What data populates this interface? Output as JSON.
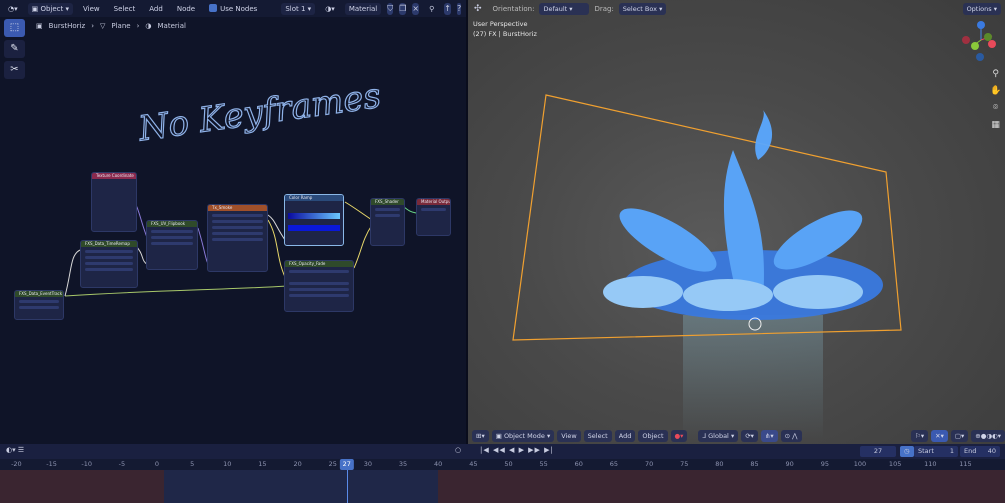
{
  "node_editor": {
    "header": {
      "editor_type_icon": "node-editor-icon",
      "mode": "Object",
      "menus": [
        "View",
        "Select",
        "Add",
        "Node"
      ],
      "use_nodes_label": "Use Nodes",
      "use_nodes": true,
      "slot": "Slot 1",
      "material": "Material"
    },
    "breadcrumb": [
      "BurstHoriz",
      "Plane",
      "Material"
    ],
    "annotation": "No Keyframes",
    "nodes": [
      {
        "title": "Texture Coordinate",
        "color": "#8a2a4e"
      },
      {
        "title": "FXS_UV_Flipbook",
        "color": "#2f4a2a"
      },
      {
        "title": "Tx_Smoke",
        "color": "#a0502a"
      },
      {
        "title": "Color Ramp",
        "color": "#2a4a7a"
      },
      {
        "title": "FXS_Shader",
        "color": "#2f4a2a"
      },
      {
        "title": "Material Output",
        "color": "#7a2a3a"
      },
      {
        "title": "FXS_Data_TimeRemap",
        "color": "#2f4a2a"
      },
      {
        "title": "FXS_Opacity_Fade",
        "color": "#2f4a2a"
      },
      {
        "title": "FXS_Data_EventTrack",
        "color": "#2f4a2a"
      }
    ]
  },
  "viewport": {
    "header": {
      "orientation_label": "Orientation:",
      "orientation": "Default",
      "drag_label": "Drag:",
      "drag": "Select Box",
      "options": "Options"
    },
    "info": {
      "view": "User Perspective",
      "object": "(27) FX | BurstHoriz"
    },
    "footer": {
      "mode": "Object Mode",
      "menus": [
        "View",
        "Select",
        "Add",
        "Object"
      ],
      "transform_orientation": "Global"
    },
    "colors": {
      "bounds": "#f0a030",
      "fx": "#5aa8ff"
    }
  },
  "timeline": {
    "current_frame": "27",
    "start_label": "Start",
    "start": "1",
    "end_label": "End",
    "end": "40",
    "ticks": [
      "-20",
      "-15",
      "-10",
      "-5",
      "0",
      "5",
      "10",
      "15",
      "20",
      "25",
      "30",
      "35",
      "40",
      "45",
      "50",
      "55",
      "60",
      "65",
      "70",
      "75",
      "80",
      "85",
      "90",
      "95",
      "100",
      "105",
      "110",
      "115"
    ]
  }
}
